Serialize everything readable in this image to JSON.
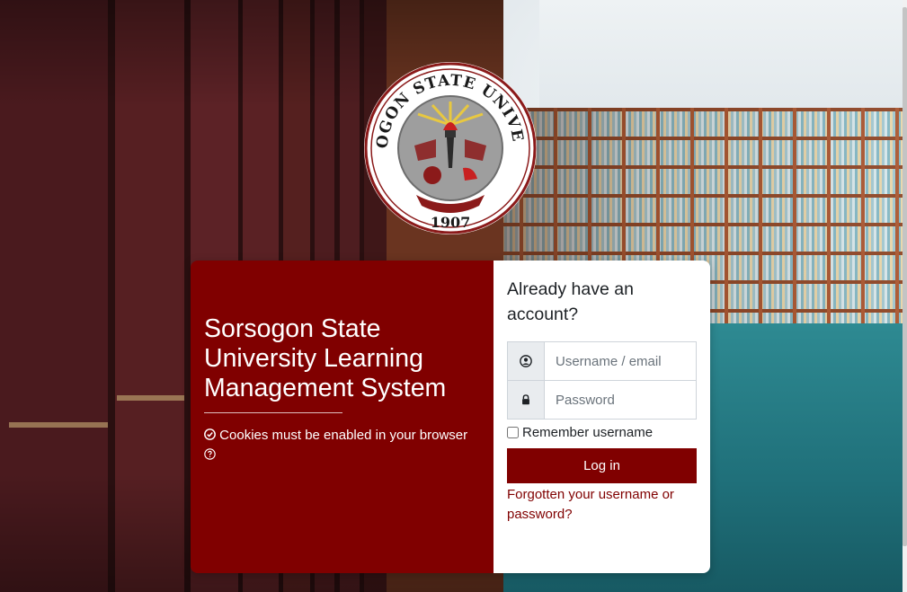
{
  "site": {
    "title": "Sorsogon State University Learning Management System",
    "logo_text_top": "SORSOGON STATE UNIVERSITY",
    "logo_year": "1907"
  },
  "notices": {
    "cookies_text": "Cookies must be enabled in your browser"
  },
  "login": {
    "heading": "Already have an account?",
    "username_placeholder": "Username / email",
    "password_placeholder": "Password",
    "remember_label": "Remember username",
    "remember_checked": false,
    "submit_label": "Log in",
    "forgot_link": "Forgotten your username or password?"
  },
  "icons": {
    "cookie_notice": "check-circle-icon",
    "help": "question-circle-icon",
    "username": "user-circle-icon",
    "password": "lock-icon"
  },
  "colors": {
    "brand": "#800000",
    "panel_text": "#ffffff",
    "input_addon_bg": "#e9ecef"
  }
}
